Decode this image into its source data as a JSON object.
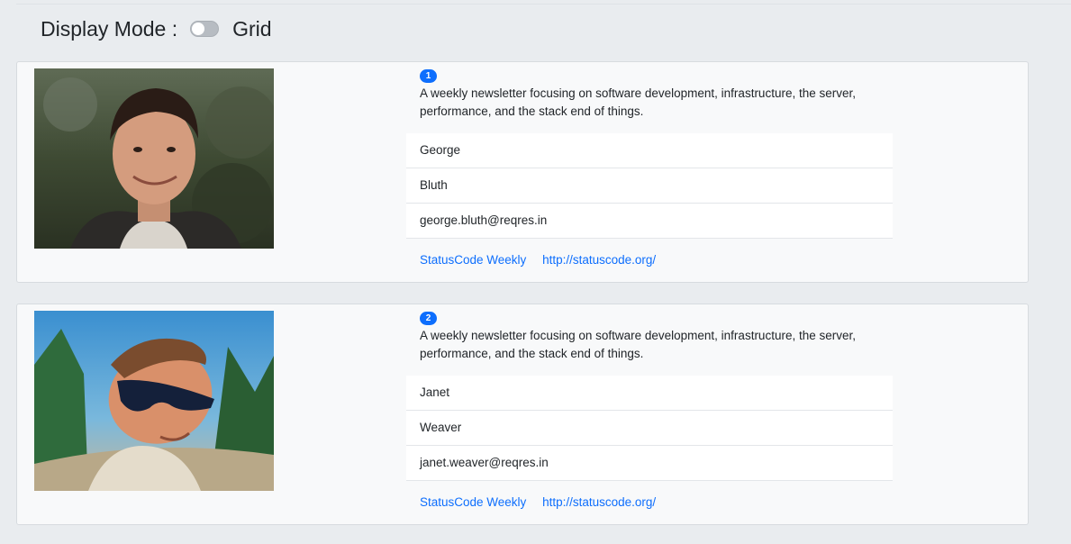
{
  "header": {
    "label": "Display Mode :",
    "mode": "Grid",
    "toggle_on": false
  },
  "cards": [
    {
      "index": "1",
      "description": "A weekly newsletter focusing on software development, infrastructure, the server, performance, and the stack end of things.",
      "first_name": "George",
      "last_name": "Bluth",
      "email": "george.bluth@reqres.in",
      "support_text": "StatusCode Weekly",
      "support_url": "http://statuscode.org/"
    },
    {
      "index": "2",
      "description": "A weekly newsletter focusing on software development, infrastructure, the server, performance, and the stack end of things.",
      "first_name": "Janet",
      "last_name": "Weaver",
      "email": "janet.weaver@reqres.in",
      "support_text": "StatusCode Weekly",
      "support_url": "http://statuscode.org/"
    }
  ],
  "colors": {
    "accent": "#0d6efd",
    "background": "#e9ecef",
    "card": "#f8f9fa"
  }
}
